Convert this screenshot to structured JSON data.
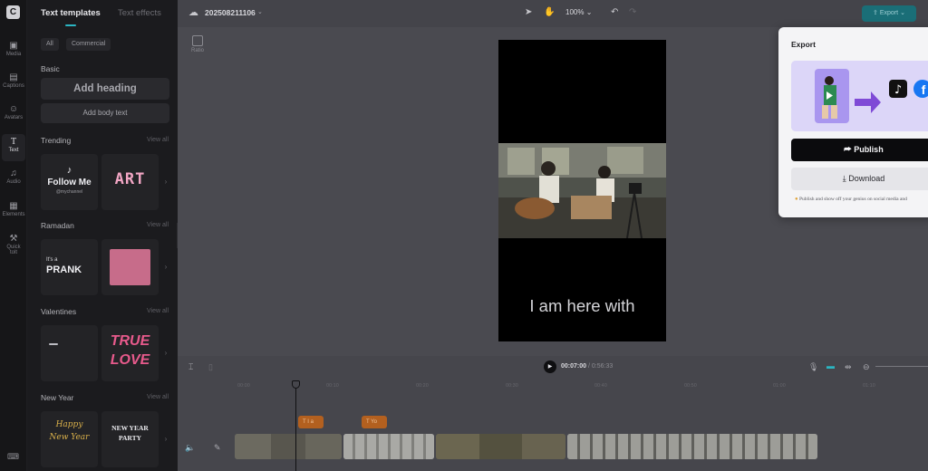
{
  "rail": {
    "items": [
      {
        "label": "Media",
        "icon": "media-icon"
      },
      {
        "label": "Captions",
        "icon": "captions-icon"
      },
      {
        "label": "Avatars",
        "icon": "avatars-icon"
      },
      {
        "label": "Text",
        "icon": "text-icon",
        "active": true
      },
      {
        "label": "Audio",
        "icon": "audio-icon"
      },
      {
        "label": "Elements",
        "icon": "elements-icon"
      },
      {
        "label": "Quick",
        "label2": "tolt",
        "icon": "quick-tool-icon"
      }
    ]
  },
  "panel": {
    "tab_templates": "Text templates",
    "tab_effects": "Text effects",
    "filter_all": "All",
    "filter_commercial": "Commercial",
    "basic": {
      "title": "Basic",
      "add_heading": "Add heading",
      "add_body": "Add body text"
    },
    "view_all": "View all",
    "sections": {
      "trending": "Trending",
      "ramadan": "Ramadan",
      "valentines": "Valentines",
      "new_year": "New Year"
    },
    "tiles": {
      "follow_me": "Follow Me",
      "follow_me_sub": "@mychannel",
      "art": "ART",
      "its_a": "It's a",
      "prank": "PRANK",
      "true_love_1": "TRUE",
      "true_love_2": "LOVE",
      "happy": "Happy",
      "new_year_script": "New Year",
      "new_year_line1": "NEW YEAR",
      "new_year_line2": "PARTY"
    }
  },
  "topbar": {
    "project_name": "202508211106",
    "zoom": "100%",
    "export_label": "Export"
  },
  "ratio_label": "Ratio",
  "canvas": {
    "caption": "I am here with"
  },
  "export_popover": {
    "title": "Export",
    "publish": "Publish",
    "download": "Download",
    "note": "Publish and show off your genius on social media and"
  },
  "timeline": {
    "current": "00:07:00",
    "duration": "/ 0:56:33",
    "ruler": [
      "00:00",
      "00:10",
      "00:20",
      "00:30",
      "00:40",
      "00:50",
      "01:00",
      "01:10"
    ],
    "text_clips": [
      "I a",
      "Yo"
    ]
  },
  "colors": {
    "accent": "#2bb5c2",
    "text_clip": "#b3601f",
    "export_button": "#1a6e77",
    "promo_bg": "#dcd6f8"
  }
}
